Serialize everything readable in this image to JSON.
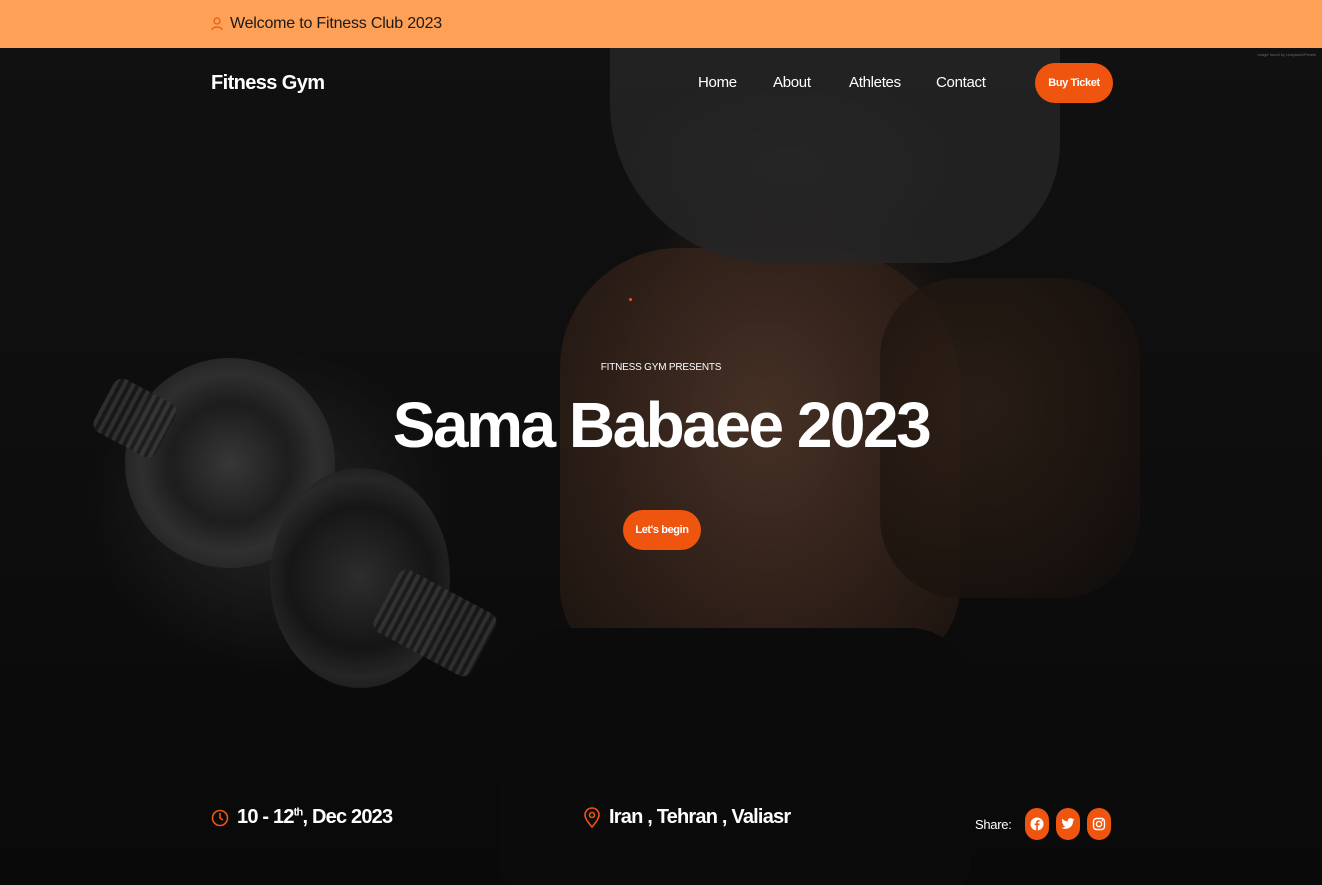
{
  "topbar": {
    "welcome_text": "Welcome to Fitness Club 2023"
  },
  "nav": {
    "brand": "Fitness Gym",
    "items": [
      {
        "label": "Home"
      },
      {
        "label": "About"
      },
      {
        "label": "Athletes"
      },
      {
        "label": "Contact"
      }
    ],
    "cta_label": "Buy Ticket"
  },
  "hero": {
    "image_credit": "Image found by Unsplash/Pexels",
    "presents": "FITNESS GYM PRESENTS",
    "title": "Sama Babaee 2023",
    "cta_label": "Let's begin"
  },
  "event": {
    "date_prefix": "10 - 12",
    "date_sup": "th",
    "date_suffix": ", Dec 2023",
    "location": "Iran , Tehran , Valiasr"
  },
  "share": {
    "label": "Share:",
    "networks": [
      {
        "icon": "facebook-icon"
      },
      {
        "icon": "twitter-icon"
      },
      {
        "icon": "instagram-icon"
      }
    ]
  },
  "colors": {
    "topbar_bg": "#ffa057",
    "accent": "#f0550f"
  }
}
